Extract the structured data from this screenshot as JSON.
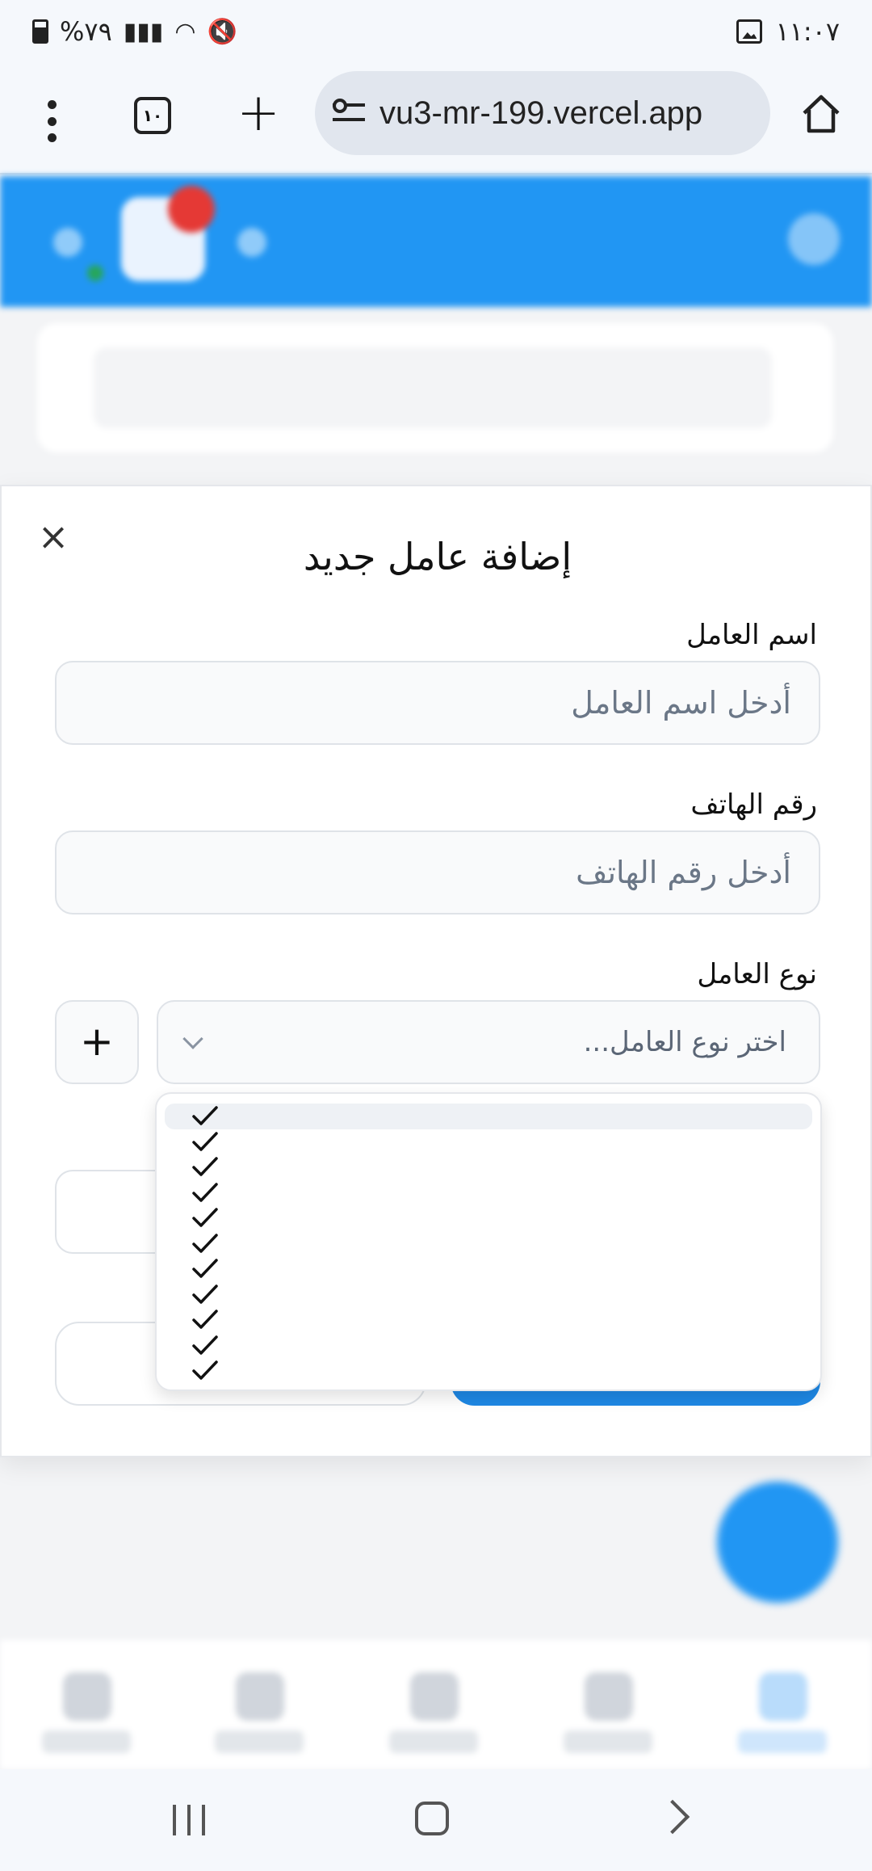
{
  "status_bar": {
    "time": "١١:٠٧",
    "battery": "%٧٩"
  },
  "browser": {
    "url": "vu3-mr-199.vercel.app",
    "tab_count": "١٠"
  },
  "modal": {
    "title": "إضافة عامل جديد",
    "close_symbol": "×",
    "name_label": "اسم العامل",
    "name_placeholder": "أدخل اسم العامل",
    "phone_label": "رقم الهاتف",
    "phone_placeholder": "أدخل رقم الهاتف",
    "type_label": "نوع العامل",
    "type_placeholder": "اختر نوع العامل...",
    "add_type_symbol": "+"
  },
  "dropdown": {
    "item_count": 11,
    "highlighted_index": 0
  },
  "colors": {
    "primary": "#2196f3",
    "notification": "#e53935",
    "online": "#26a65b"
  }
}
